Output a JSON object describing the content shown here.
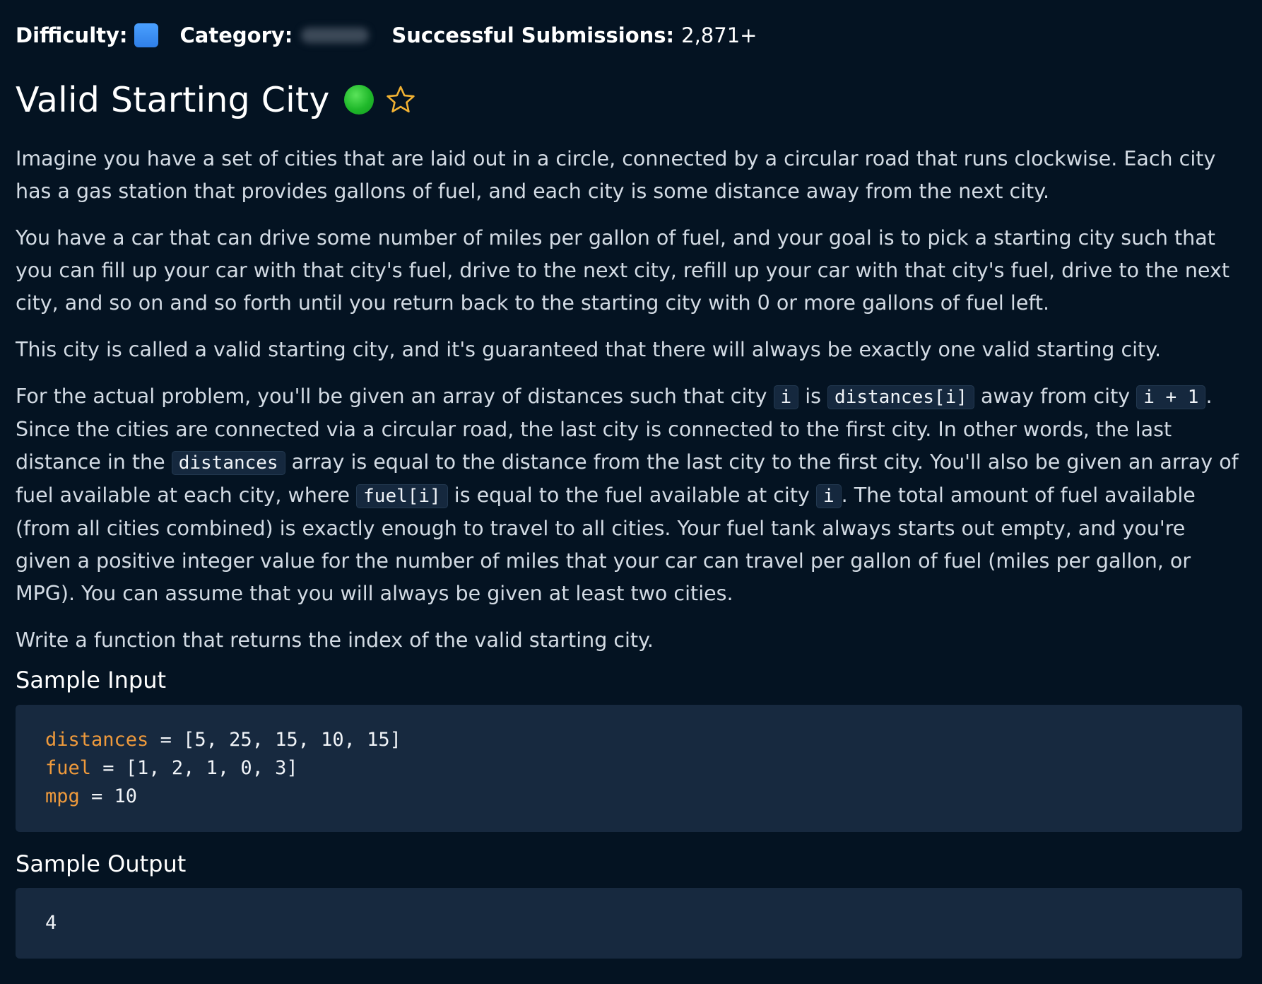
{
  "meta": {
    "difficulty_label": "Difficulty:",
    "category_label": "Category:",
    "submissions_label": "Successful Submissions:",
    "submissions_value": "2,871+",
    "difficulty_color": "#3b8ef3"
  },
  "problem": {
    "title": "Valid Starting City",
    "status_color": "#22c02e",
    "star_icon": "star-outline-icon",
    "star_color": "#f2b233"
  },
  "description": {
    "p1": "Imagine you have a set of cities that are laid out in a circle, connected by a circular road that runs clockwise. Each city has a gas station that provides gallons of fuel, and each city is some distance away from the next city.",
    "p2": "You have a car that can drive some number of miles per gallon of fuel, and your goal is to pick a starting city such that you can fill up your car with that city's fuel, drive to the next city, refill up your car with that city's fuel, drive to the next city, and so on and so forth until you return back to the starting city with 0 or more gallons of fuel left.",
    "p3": "This city is called a valid starting city, and it's guaranteed that there will always be exactly one valid starting city.",
    "p4": {
      "t1": "For the actual problem, you'll be given an array of distances such that city ",
      "c1": "i",
      "t2": " is ",
      "c2": "distances[i]",
      "t3": " away from city ",
      "c3": "i + 1",
      "t4": ". Since the cities are connected via a circular road, the last city is connected to the first city. In other words, the last distance in the ",
      "c4": "distances",
      "t5": " array is equal to the distance from the last city to the first city. You'll also be given an array of fuel available at each city, where ",
      "c5": "fuel[i]",
      "t6": " is equal to the fuel available at city ",
      "c6": "i",
      "t7": ". The total amount of fuel available (from all cities combined) is exactly enough to travel to all cities. Your fuel tank always starts out empty, and you're given a positive integer value for the number of miles that your car can travel per gallon of fuel (miles per gallon, or MPG). You can assume that you will always be given at least two cities."
    },
    "p5": "Write a function that returns the index of the valid starting city."
  },
  "sample_input": {
    "heading": "Sample Input",
    "lines": [
      {
        "var": "distances",
        "rest": " = [5, 25, 15, 10, 15]"
      },
      {
        "var": "fuel",
        "rest": " = [1, 2, 1, 0, 3]"
      },
      {
        "var": "mpg",
        "rest": " = 10"
      }
    ]
  },
  "sample_output": {
    "heading": "Sample Output",
    "value": "4"
  }
}
